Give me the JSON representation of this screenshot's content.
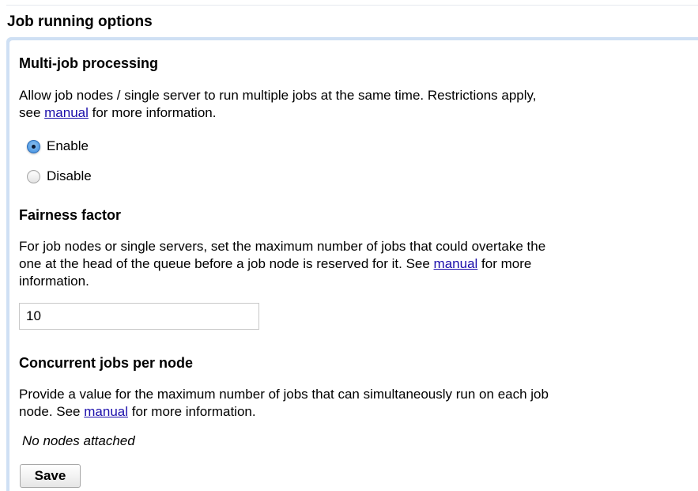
{
  "section": {
    "title": "Job running options"
  },
  "multi_job": {
    "title": "Multi-job processing",
    "desc_before": "Allow job nodes / single server to run multiple jobs at the same time. Restrictions apply,",
    "desc_see": "see ",
    "link": "manual",
    "desc_after": " for more information.",
    "options": [
      {
        "label": "Enable",
        "checked": true
      },
      {
        "label": "Disable",
        "checked": false
      }
    ]
  },
  "fairness": {
    "title": "Fairness factor",
    "desc_line1": "For job nodes or single servers, set the maximum number of jobs that could overtake the",
    "desc_line2_before": "one at the head of the queue before a job node is reserved for it. See ",
    "link": "manual",
    "desc_line2_after": " for more",
    "desc_line3": "information.",
    "value": "10"
  },
  "concurrent": {
    "title": "Concurrent jobs per node",
    "desc_line1": "Provide a value for the maximum number of jobs that can simultaneously run on each job",
    "desc_line2_before": "node. See ",
    "link": "manual",
    "desc_line2_after": " for more information.",
    "status": "No nodes attached"
  },
  "save_label": "Save"
}
